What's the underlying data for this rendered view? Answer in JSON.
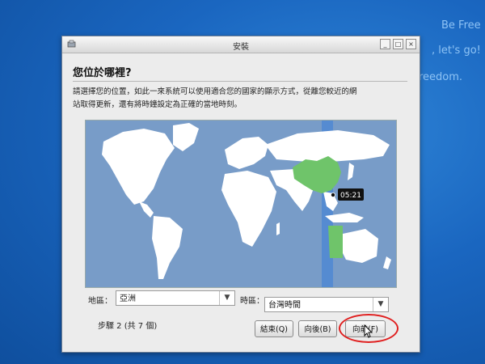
{
  "desktop": {
    "line1": "Be Free",
    "line2": ", let's go!",
    "line3": "reedom."
  },
  "window": {
    "title": "安裝",
    "heading": "您位於哪裡?",
    "description": "請選擇您的位置，如此一來系統可以使用適合您的國家的顯示方式，從離您較近的網\n站取得更新，還有將時鐘設定為正確的當地時刻。",
    "map": {
      "time": "05:21",
      "highlight_color": "#6fc46a",
      "ocean_color": "#789cc8",
      "land_color": "#ffffff"
    },
    "region": {
      "label": "地區：",
      "value": "亞洲"
    },
    "timezone": {
      "label": "時區：",
      "value": "台灣時間"
    },
    "step": "步驟 2 (共 7 個)",
    "buttons": {
      "quit": "結束(Q)",
      "back": "向後(B)",
      "forward": "向前(F)"
    }
  }
}
